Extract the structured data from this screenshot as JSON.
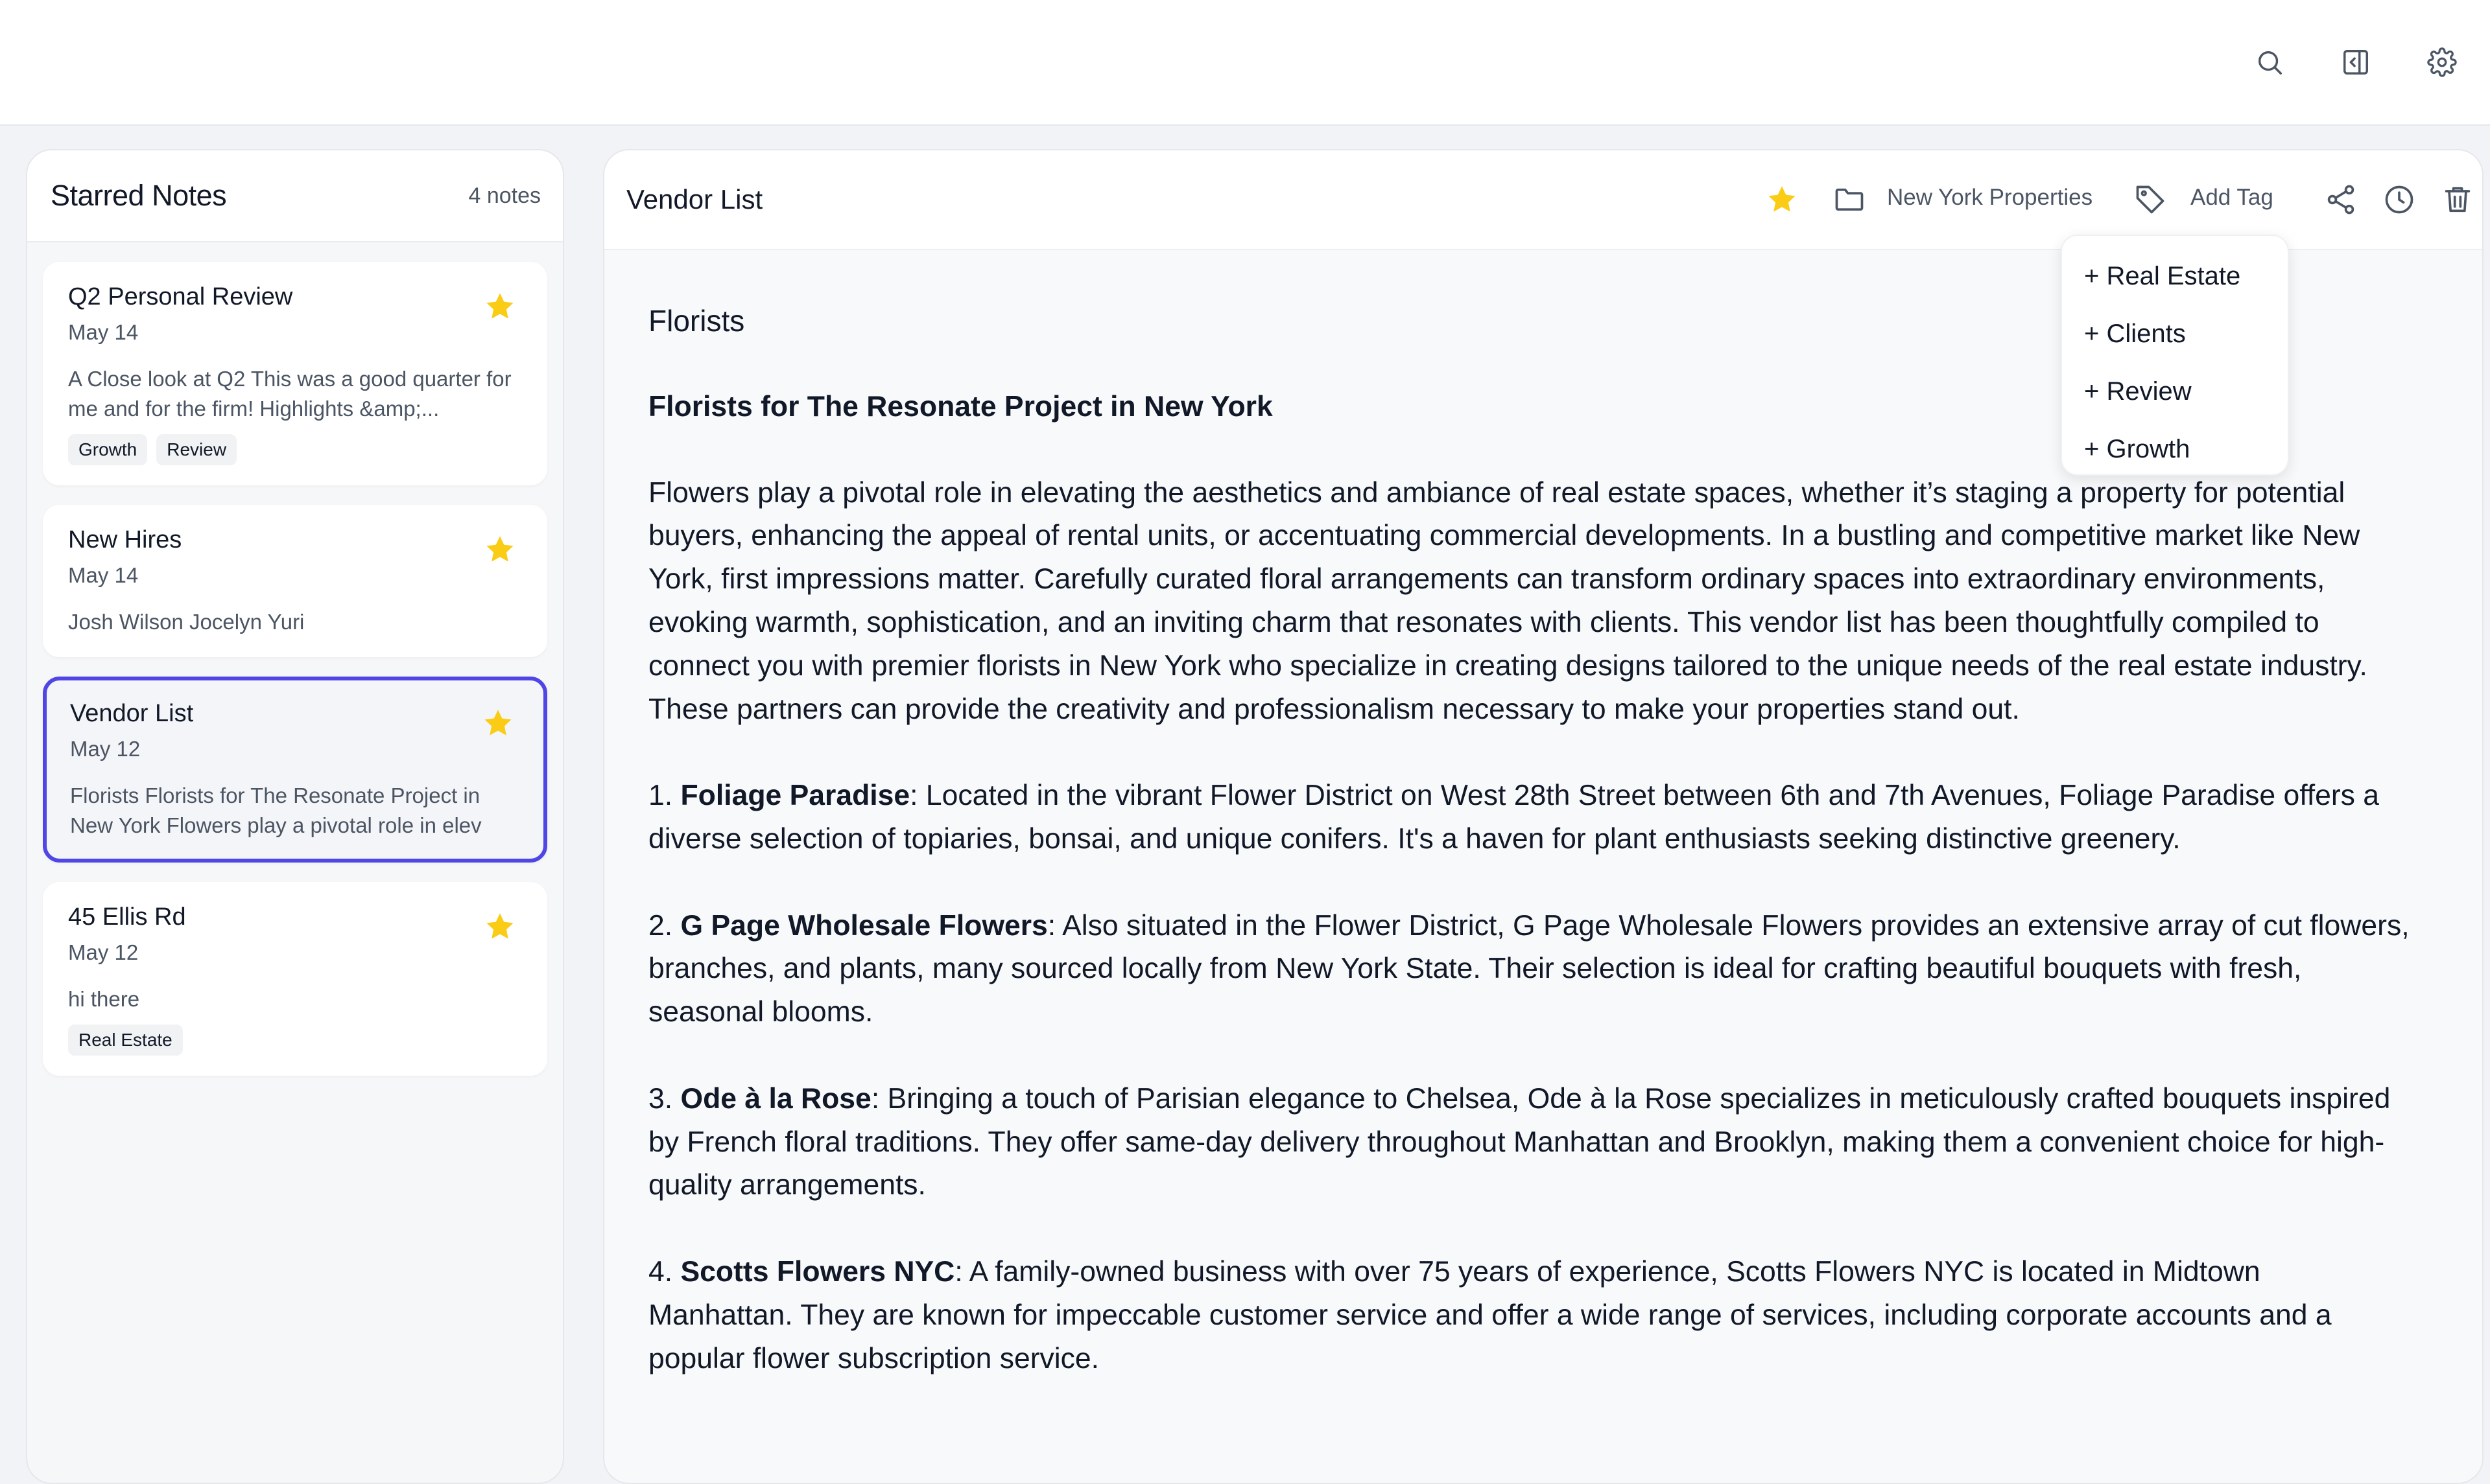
{
  "colors": {
    "accent": "#4f46e5",
    "star": "#facc15",
    "muted": "#4b5563"
  },
  "topbar": {
    "icons": [
      "search-icon",
      "sidebar-toggle-icon",
      "gear-icon"
    ]
  },
  "sidebar": {
    "title": "Starred Notes",
    "count": "4 notes",
    "notes": [
      {
        "title": "Q2 Personal Review",
        "date": "May 14",
        "preview": "A Close look at Q2 This was a good quarter for me and for the firm! Highlights &amp;...",
        "tags": [
          "Growth",
          "Review"
        ],
        "starred": true,
        "selected": false
      },
      {
        "title": "New Hires",
        "date": "May 14",
        "preview": "Josh Wilson Jocelyn Yuri",
        "tags": [],
        "starred": true,
        "selected": false
      },
      {
        "title": "Vendor List",
        "date": "May 12",
        "preview": "Florists Florists for The Resonate Project in New York Flowers play a pivotal role in elev",
        "tags": [],
        "starred": true,
        "selected": true
      },
      {
        "title": "45 Ellis Rd",
        "date": "May 12",
        "preview": "hi there",
        "tags": [
          "Real Estate"
        ],
        "starred": true,
        "selected": false
      }
    ]
  },
  "editor": {
    "title": "Vendor List",
    "folder": "New York Properties",
    "add_tag": "Add Tag",
    "tag_options": [
      "+ Real Estate",
      "+ Clients",
      "+ Review",
      "+ Growth"
    ],
    "heading": "Florists",
    "subheading": "Florists for The Resonate Project in New York",
    "intro": "Flowers play a pivotal role in elevating the aesthetics and ambiance of real estate spaces, whether it’s staging a property for potential buyers, enhancing the appeal of rental units, or accentuating commercial developments. In a bustling and competitive market like New York, first impressions matter. Carefully curated floral arrangements can transform ordinary spaces into extraordinary environments, evoking warmth, sophistication, and an inviting charm that resonates with clients. This vendor list has been thoughtfully compiled to connect you with premier florists in New York who specialize in creating designs tailored to the unique needs of the real estate industry. These partners can provide the creativity and professionalism necessary to make your properties stand out.",
    "vendors": [
      {
        "num": "1. ",
        "name": "Foliage Paradise",
        "desc": ": Located in the vibrant Flower District on West 28th Street between 6th and 7th Avenues, Foliage Paradise offers a diverse selection of topiaries, bonsai, and unique conifers. It's a haven for plant enthusiasts seeking distinctive greenery."
      },
      {
        "num": "2. ",
        "name": "G Page Wholesale Flowers",
        "desc": ": Also situated in the Flower District, G Page Wholesale Flowers provides an extensive array of cut flowers, branches, and plants, many sourced locally from New York State. Their selection is ideal for crafting beautiful bouquets with fresh, seasonal blooms."
      },
      {
        "num": "3. ",
        "name": "Ode à la Rose",
        "desc": ": Bringing a touch of Parisian elegance to Chelsea, Ode à la Rose specializes in meticulously crafted bouquets inspired by French floral traditions. They offer same-day delivery throughout Manhattan and Brooklyn, making them a convenient choice for high-quality arrangements."
      },
      {
        "num": "4. ",
        "name": "Scotts Flowers NYC",
        "desc": ": A family-owned business with over 75 years of experience, Scotts Flowers NYC is located in Midtown Manhattan. They are known for impeccable customer service and offer a wide range of services, including corporate accounts and a popular flower subscription service."
      }
    ]
  }
}
